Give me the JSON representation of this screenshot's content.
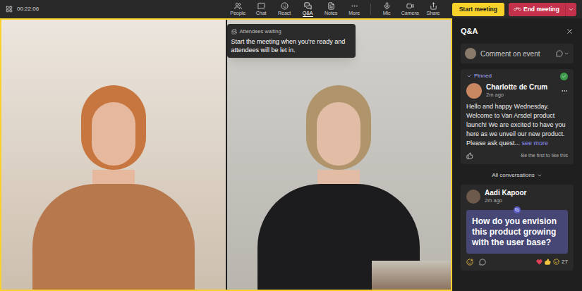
{
  "top_bar": {
    "timer": "00:22:06",
    "tools": [
      {
        "label": "People",
        "selected": false
      },
      {
        "label": "Chat",
        "selected": false
      },
      {
        "label": "React",
        "selected": false
      },
      {
        "label": "Q&A",
        "selected": true
      },
      {
        "label": "Notes",
        "selected": false
      },
      {
        "label": "More",
        "selected": false
      }
    ],
    "devices": [
      "Mic",
      "Camera",
      "Share"
    ],
    "start_button": "Start meeting",
    "end_button": "End meeting"
  },
  "stage": {
    "highlighted": true,
    "tooltip": {
      "title": "Attendees waiting",
      "body": "Start the meeting when you're ready and attendees will be let in."
    }
  },
  "qa_panel": {
    "title": "Q&A",
    "comment_placeholder": "Comment on event",
    "pinned": {
      "label": "Pinned",
      "author": "Charlotte de Crum",
      "time": "2m ago",
      "body": "Hello and happy Wednesday. Welcome to Van Arsdel product launch! We are excited to have you here as we unveil our new product. Please ask quest...",
      "see_more": "see more",
      "like_prompt": "Be the first to like this"
    },
    "filter": "All conversations",
    "questions": [
      {
        "author": "Aadi Kapoor",
        "time": "2m ago",
        "text": "How do you envision this product growing with the user base?",
        "reaction_count": "27"
      }
    ]
  }
}
